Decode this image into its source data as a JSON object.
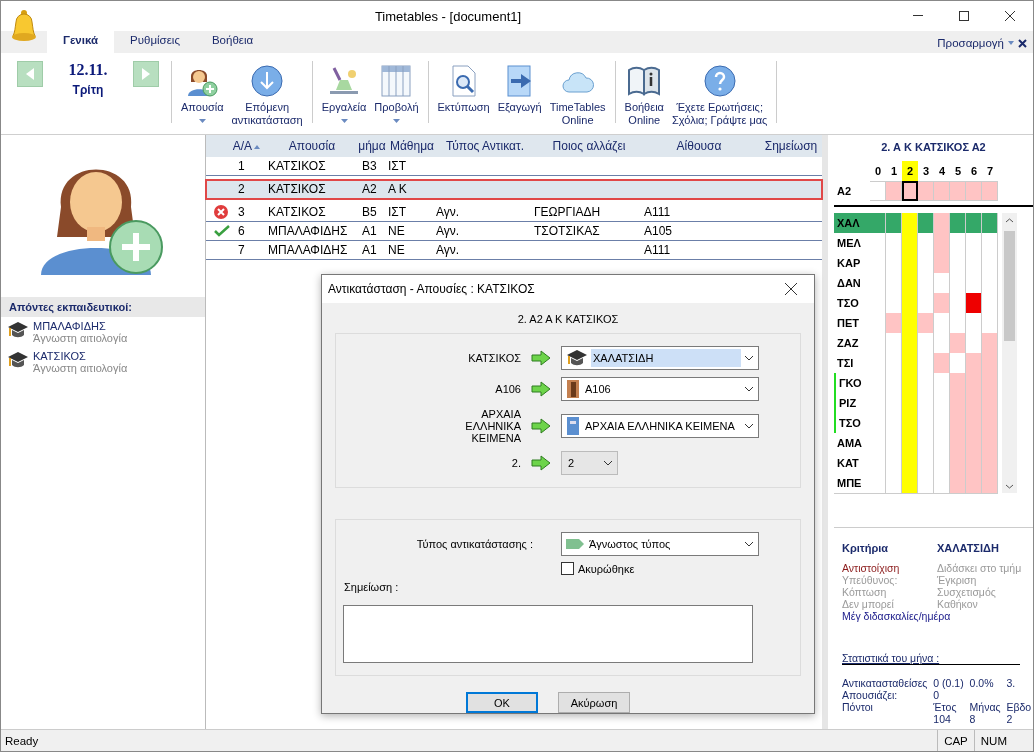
{
  "window": {
    "title": "Timetables - [document1]"
  },
  "ribbon_tabs": [
    {
      "label": "Γενικά",
      "selected": true
    },
    {
      "label": "Ρυθμίσεις",
      "selected": false
    },
    {
      "label": "Βοήθεια",
      "selected": false
    }
  ],
  "customize": {
    "label": "Προσαρμογή"
  },
  "date": {
    "day": "12.11.",
    "weekday": "Τρίτη"
  },
  "toolbar_groups": [
    {
      "items": [
        {
          "kind": "absence",
          "lines": [
            "Απουσία"
          ],
          "dropdown": true
        },
        {
          "kind": "next",
          "lines": [
            "Επόμενη",
            "αντικατάσταση"
          ],
          "dropdown": false
        }
      ]
    },
    {
      "items": [
        {
          "kind": "tools",
          "lines": [
            "Εργαλεία"
          ],
          "dropdown": true
        },
        {
          "kind": "view",
          "lines": [
            "Προβολή"
          ],
          "dropdown": true
        }
      ]
    },
    {
      "items": [
        {
          "kind": "print",
          "lines": [
            "Εκτύπωση"
          ],
          "dropdown": false
        },
        {
          "kind": "export",
          "lines": [
            "Εξαγωγή"
          ],
          "dropdown": false
        },
        {
          "kind": "online",
          "lines": [
            "TimeTables",
            "Online"
          ],
          "dropdown": false
        }
      ]
    },
    {
      "items": [
        {
          "kind": "help",
          "lines": [
            "Βοήθεια",
            "Online"
          ],
          "dropdown": false
        },
        {
          "kind": "contact",
          "lines": [
            "Έχετε Ερωτήσεις;",
            "Σχόλια; Γράψτε μας"
          ],
          "dropdown": false
        }
      ]
    }
  ],
  "absent_teachers": {
    "title": "Απόντες εκπαιδευτικοί:",
    "items": [
      {
        "name": "ΜΠΑΛΑΦΙΔΗΣ",
        "reason": "Άγνωστη αιτιολογία"
      },
      {
        "name": "ΚΑΤΣΙΚΟΣ",
        "reason": "Άγνωστη αιτιολογία"
      }
    ]
  },
  "table": {
    "columns": [
      "Α/Α",
      "Απουσία",
      "μήμα",
      "Μάθημα",
      "Τύπος Αντικατ.",
      "Ποιος αλλάζει",
      "Αίθουσα",
      "Σημείωση"
    ],
    "rows": [
      {
        "kind": "plain",
        "selected": false,
        "number": "1",
        "absence": "ΚΑΤΣΙΚΟΣ",
        "class": "Β3",
        "subject": "ΙΣΤ"
      },
      {
        "kind": "plain",
        "selected": true,
        "number": "2",
        "absence": "ΚΑΤΣΙΚΟΣ",
        "class": "Α2",
        "subject": "Α Κ"
      },
      {
        "kind": "error",
        "selected": false,
        "number": "3",
        "absence": "ΚΑΤΣΙΚΟΣ",
        "class": "Β5",
        "subject": "ΙΣΤ",
        "type": "Αγν.",
        "substitute": "ΓΕΩΡΓΙΑΔΗ",
        "room": "Α111"
      },
      {
        "kind": "done",
        "selected": false,
        "number": "6",
        "absence": "ΜΠΑΛΑΦΙΔΗΣ",
        "class": "Α1",
        "subject": "ΝΕ",
        "type": "Αγν.",
        "substitute": "ΤΣΟΤΣΙΚΑΣ",
        "room": "Α105"
      },
      {
        "kind": "plain",
        "selected": false,
        "number": "7",
        "absence": "ΜΠΑΛΑΦΙΔΗΣ",
        "class": "Α1",
        "subject": "ΝΕ",
        "type": "Αγν.",
        "room": "Α111"
      }
    ]
  },
  "dialog": {
    "title": "Αντικατάσταση - Απουσίες : ΚΑΤΣΙΚΟΣ",
    "heading": "2. Α2  Α Κ ΚΑΤΣΙΚΟΣ",
    "fields": [
      {
        "kind": "teacher",
        "label": "ΚΑΤΣΙΚΟΣ",
        "value": "ΧΑΛΑΤΣΙΔΗ",
        "focused": true
      },
      {
        "kind": "room",
        "label": "Α106",
        "value": "Α106",
        "focused": false
      },
      {
        "kind": "subject",
        "label": "ΑΡΧΑΙΑ ΕΛΛΗΝΙΚΑ ΚΕΙΜΕΝΑ",
        "value": "ΑΡΧΑΙΑ ΕΛΛΗΝΙΚΑ ΚΕΙΜΕΝΑ",
        "focused": false
      },
      {
        "kind": "period",
        "label": "2.",
        "value": "2",
        "focused": false
      }
    ],
    "type_label": "Τύπος αντικατάστασης :",
    "type_value": "Άγνωστος τύπος",
    "cancelled": {
      "label": "Ακυρώθηκε",
      "checked": false
    },
    "note_label": "Σημείωση :",
    "buttons": [
      {
        "label": "OK",
        "default": true
      },
      {
        "label": "Ακύρωση",
        "default": false
      }
    ]
  },
  "grid": {
    "title": "2. Α Κ ΚΑΤΣΙΚΟΣ Α2",
    "periods": [
      {
        "label": "0",
        "selected": false
      },
      {
        "label": "1",
        "selected": false
      },
      {
        "label": "2",
        "selected": true
      },
      {
        "label": "3",
        "selected": false
      },
      {
        "label": "4",
        "selected": false
      },
      {
        "label": "5",
        "selected": false
      },
      {
        "label": "6",
        "selected": false
      },
      {
        "label": "7",
        "selected": false
      }
    ],
    "class_row": {
      "label": "Α2",
      "cells": [
        {
          "kind": "free"
        },
        {
          "kind": "busy"
        },
        {
          "kind": "busy"
        },
        {
          "kind": "busy"
        },
        {
          "kind": "busy"
        },
        {
          "kind": "busy"
        },
        {
          "kind": "busy"
        },
        {
          "kind": "busy"
        }
      ]
    },
    "teachers": [
      {
        "label": "ΧΑΛ",
        "selected": true,
        "marked": false,
        "cells": [
          {
            "kind": "match"
          },
          {
            "kind": "match"
          },
          null,
          {
            "kind": "match"
          },
          {
            "kind": "busy"
          },
          {
            "kind": "match"
          },
          {
            "kind": "match"
          },
          {
            "kind": "match"
          }
        ]
      },
      {
        "label": "ΜΕΛ",
        "selected": false,
        "marked": false,
        "cells": [
          {
            "kind": "free"
          },
          {
            "kind": "free"
          },
          null,
          {
            "kind": "free"
          },
          {
            "kind": "busy"
          },
          {
            "kind": "free"
          },
          {
            "kind": "free"
          },
          {
            "kind": "free"
          }
        ]
      },
      {
        "label": "ΚΑΡ",
        "selected": false,
        "marked": false,
        "cells": [
          {
            "kind": "free"
          },
          {
            "kind": "free"
          },
          null,
          {
            "kind": "free"
          },
          {
            "kind": "busy"
          },
          {
            "kind": "free"
          },
          {
            "kind": "free"
          },
          {
            "kind": "free"
          }
        ]
      },
      {
        "label": "ΔΑΝ",
        "selected": false,
        "marked": false,
        "cells": [
          {
            "kind": "free"
          },
          {
            "kind": "free"
          },
          null,
          {
            "kind": "free"
          },
          {
            "kind": "free"
          },
          {
            "kind": "free"
          },
          {
            "kind": "free"
          },
          {
            "kind": "free"
          }
        ]
      },
      {
        "label": "ΤΣΟ",
        "selected": false,
        "marked": false,
        "cells": [
          {
            "kind": "free"
          },
          {
            "kind": "free"
          },
          null,
          {
            "kind": "free"
          },
          {
            "kind": "busy"
          },
          {
            "kind": "free"
          },
          {
            "kind": "conflict"
          },
          {
            "kind": "free"
          }
        ]
      },
      {
        "label": "ΠΕΤ",
        "selected": false,
        "marked": false,
        "cells": [
          {
            "kind": "free"
          },
          {
            "kind": "busy"
          },
          null,
          {
            "kind": "busy"
          },
          {
            "kind": "free"
          },
          {
            "kind": "free"
          },
          {
            "kind": "free"
          },
          {
            "kind": "free"
          }
        ]
      },
      {
        "label": "ΖΑΖ",
        "selected": false,
        "marked": false,
        "cells": [
          {
            "kind": "free"
          },
          {
            "kind": "free"
          },
          null,
          {
            "kind": "free"
          },
          {
            "kind": "free"
          },
          {
            "kind": "busy"
          },
          {
            "kind": "free"
          },
          {
            "kind": "busy"
          }
        ]
      },
      {
        "label": "ΤΣΙ",
        "selected": false,
        "marked": false,
        "cells": [
          {
            "kind": "free"
          },
          {
            "kind": "free"
          },
          null,
          {
            "kind": "free"
          },
          {
            "kind": "busy"
          },
          {
            "kind": "free"
          },
          {
            "kind": "busy"
          },
          {
            "kind": "busy"
          }
        ]
      },
      {
        "label": "ΓΚΟ",
        "selected": false,
        "marked": true,
        "cells": [
          {
            "kind": "free"
          },
          {
            "kind": "free"
          },
          null,
          {
            "kind": "free"
          },
          {
            "kind": "free"
          },
          {
            "kind": "busy"
          },
          {
            "kind": "busy"
          },
          {
            "kind": "busy"
          }
        ]
      },
      {
        "label": "ΡΙΖ",
        "selected": false,
        "marked": true,
        "cells": [
          {
            "kind": "free"
          },
          {
            "kind": "free"
          },
          null,
          {
            "kind": "free"
          },
          {
            "kind": "free"
          },
          {
            "kind": "busy"
          },
          {
            "kind": "busy"
          },
          {
            "kind": "busy"
          }
        ]
      },
      {
        "label": "ΤΣΟ",
        "selected": false,
        "marked": true,
        "cells": [
          {
            "kind": "free"
          },
          {
            "kind": "free"
          },
          null,
          {
            "kind": "free"
          },
          {
            "kind": "free"
          },
          {
            "kind": "busy"
          },
          {
            "kind": "busy"
          },
          {
            "kind": "busy"
          }
        ]
      },
      {
        "label": "ΑΜΑ",
        "selected": false,
        "marked": false,
        "cells": [
          {
            "kind": "free"
          },
          {
            "kind": "free"
          },
          null,
          {
            "kind": "free"
          },
          {
            "kind": "free"
          },
          {
            "kind": "busy"
          },
          {
            "kind": "busy"
          },
          {
            "kind": "busy"
          }
        ]
      },
      {
        "label": "ΚΑΤ",
        "selected": false,
        "marked": false,
        "cells": [
          {
            "kind": "free"
          },
          {
            "kind": "free"
          },
          null,
          {
            "kind": "free"
          },
          {
            "kind": "free"
          },
          {
            "kind": "busy"
          },
          {
            "kind": "busy"
          },
          {
            "kind": "busy"
          }
        ]
      },
      {
        "label": "ΜΠΕ",
        "selected": false,
        "marked": false,
        "cells": [
          {
            "kind": "free"
          },
          {
            "kind": "free"
          },
          null,
          {
            "kind": "free"
          },
          {
            "kind": "free"
          },
          {
            "kind": "busy"
          },
          {
            "kind": "busy"
          },
          {
            "kind": "busy"
          }
        ]
      }
    ]
  },
  "criteria": {
    "title": "Κριτήρια",
    "teacher": "ΧΑΛΑΤΣΙΔΗ",
    "items": [
      {
        "label": "Αντιστοίχιση",
        "kind": "met"
      },
      {
        "label": "Διδάσκει στο τμήμ",
        "kind": "unmet"
      },
      {
        "label": "Υπεύθυνος:",
        "kind": "unmet"
      },
      {
        "label": "Έγκριση",
        "kind": "unmet"
      },
      {
        "label": "Κόπτωση",
        "kind": "unmet"
      },
      {
        "label": "Συσχετισμός",
        "kind": "unmet"
      },
      {
        "label": "Δεν μπορεί",
        "kind": "unmet"
      },
      {
        "label": "Καθήκον",
        "kind": "unmet"
      },
      {
        "label": "Μέγ διδασκαλίες/ημέρα",
        "kind": "info"
      }
    ]
  },
  "stats": {
    "title": "Στατιστικά του μήνα :",
    "rows": [
      {
        "col_1": "Αντικατασταθείσες",
        "col_2": "0 (0.1)",
        "col_3": "0.0%",
        "col_4": "3."
      },
      {
        "col_1": "Απουσιάζει:",
        "col_2": "0"
      },
      {
        "col_1": "Πόντοι",
        "col_2": "Έτος",
        "col_3": "Μήνας",
        "col_4": "Εβδο"
      },
      {
        "col_2": "104",
        "col_3": "8",
        "col_4": "2"
      }
    ]
  },
  "status_bar": {
    "text": "Ready",
    "indicators": [
      "CAP",
      "NUM"
    ]
  }
}
